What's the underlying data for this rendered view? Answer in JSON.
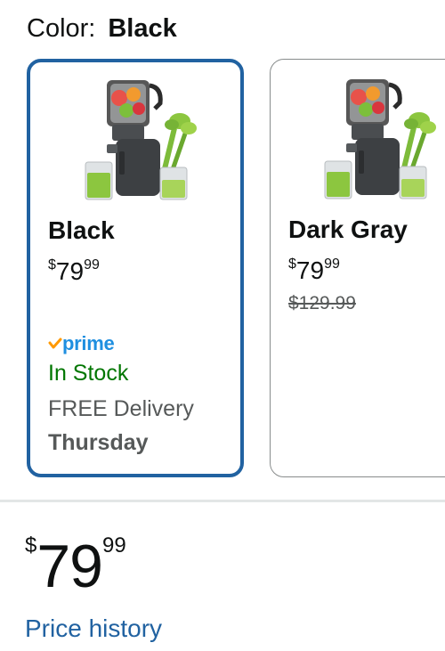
{
  "color_selector": {
    "label": "Color:",
    "selected_value": "Black"
  },
  "swatches": [
    {
      "name": "Black",
      "price_symbol": "$",
      "price_whole": "79",
      "price_fraction": "99",
      "prime_label": "prime",
      "stock": "In Stock",
      "delivery": "FREE Delivery",
      "delivery_day": "Thursday",
      "selected": true
    },
    {
      "name": "Dark Gray",
      "price_symbol": "$",
      "price_whole": "79",
      "price_fraction": "99",
      "list_price": "$129.99",
      "selected": false
    }
  ],
  "buybox": {
    "price_symbol": "$",
    "price_whole": "79",
    "price_fraction": "99",
    "price_history_link": "Price history"
  },
  "colors": {
    "selected_border": "#2162a1",
    "in_stock": "#007600",
    "prime_blue": "#1f8fe0",
    "prime_check": "#ff9900",
    "link": "#2162a1"
  }
}
